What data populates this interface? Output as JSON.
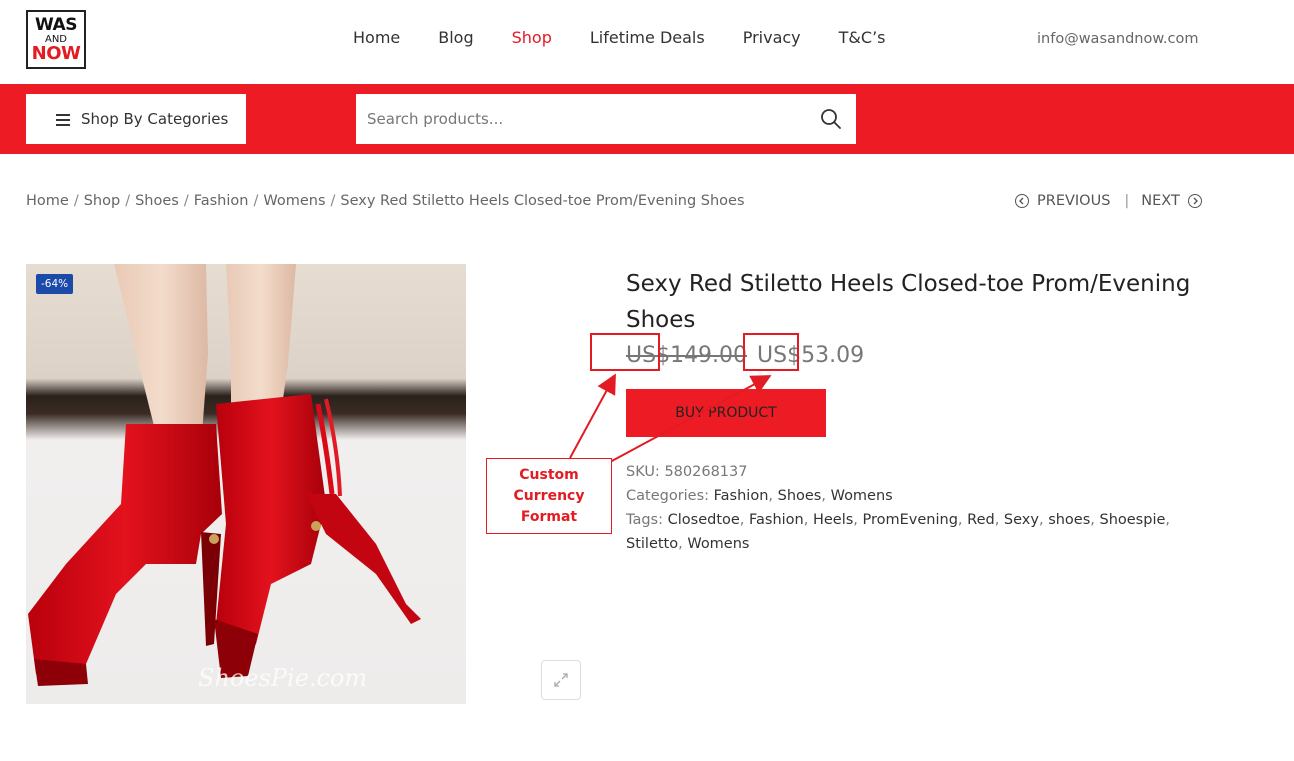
{
  "header": {
    "logo": {
      "line1": "WAS",
      "line2": "AND",
      "line3": "NOW"
    },
    "nav": [
      {
        "label": "Home",
        "active": false
      },
      {
        "label": "Blog",
        "active": false
      },
      {
        "label": "Shop",
        "active": true
      },
      {
        "label": "Lifetime Deals",
        "active": false
      },
      {
        "label": "Privacy",
        "active": false
      },
      {
        "label": "T&C’s",
        "active": false
      }
    ],
    "email": "info@wasandnow.com"
  },
  "toolbar": {
    "categories_label": "Shop By Categories",
    "search_placeholder": "Search products...",
    "search_value": ""
  },
  "breadcrumb": [
    "Home",
    "Shop",
    "Shoes",
    "Fashion",
    "Womens",
    "Sexy Red Stiletto Heels Closed-toe Prom/Evening Shoes"
  ],
  "pager": {
    "previous": "PREVIOUS",
    "next": "NEXT"
  },
  "product": {
    "badge": "-64%",
    "watermark": "ShoesPie.com",
    "title": "Sexy Red Stiletto Heels Closed-toe Prom/Evening Shoes",
    "old_price": "US$149.00",
    "new_price": "US$53.09",
    "buy_label": "BUY PRODUCT",
    "sku_label": "SKU:",
    "sku": "580268137",
    "categories_label": "Categories:",
    "categories": [
      "Fashion",
      "Shoes",
      "Womens"
    ],
    "tags_label": "Tags:",
    "tags": [
      "Closedtoe",
      "Fashion",
      "Heels",
      "PromEvening",
      "Red",
      "Sexy",
      "shoes",
      "Shoespie",
      "Stiletto",
      "Womens"
    ]
  },
  "annotation": {
    "line1": "Custom",
    "line2": "Currency",
    "line3": "Format",
    "color": "#e31b23"
  },
  "colors": {
    "brand_red": "#ed1c24",
    "badge_blue": "#1c4aa8"
  }
}
